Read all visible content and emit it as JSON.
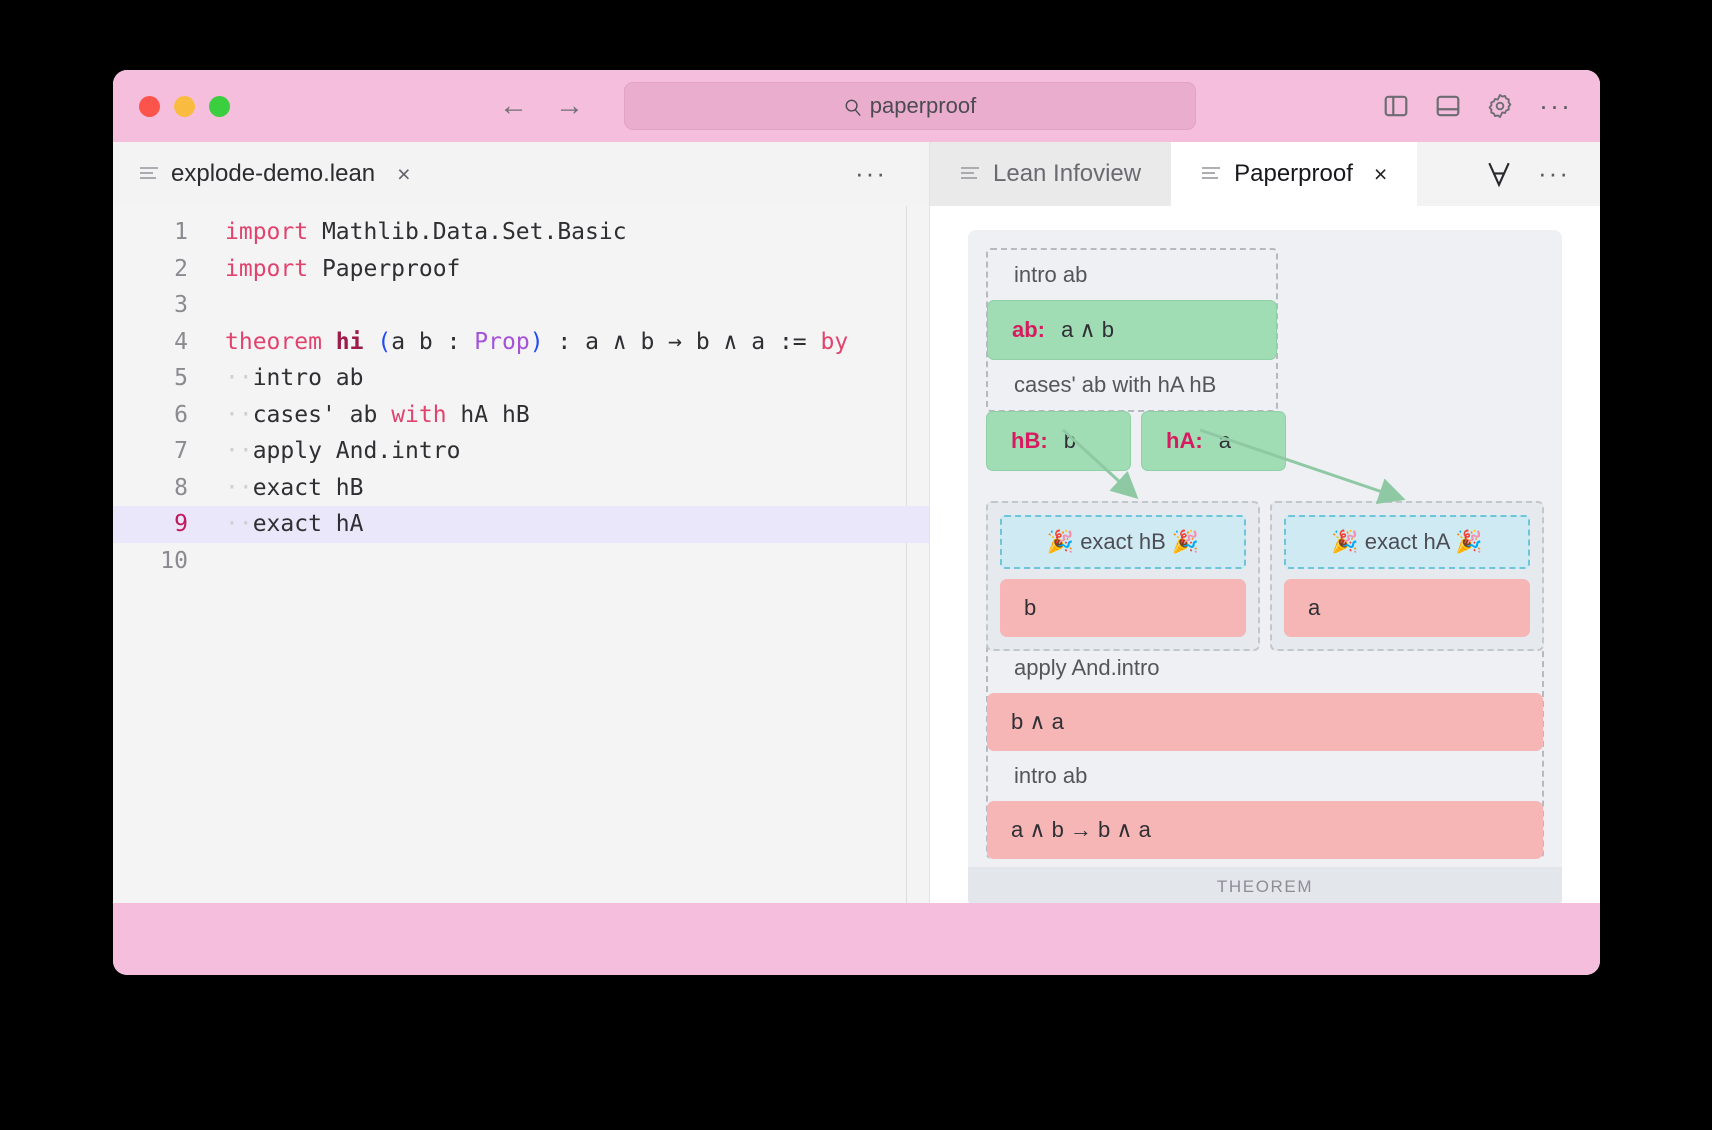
{
  "titlebar": {
    "search_value": "paperproof",
    "search_icon": "search-icon",
    "back_icon": "←",
    "forward_icon": "→",
    "overflow": "···",
    "accent_color": "#f4bedc"
  },
  "editor": {
    "tab_label": "explode-demo.lean",
    "tab_close": "×",
    "overflow": "···",
    "active_line": 9,
    "lines": [
      {
        "n": "1",
        "segments": [
          {
            "t": "import ",
            "c": "kw"
          },
          {
            "t": "Mathlib.Data.Set.Basic",
            "c": ""
          }
        ]
      },
      {
        "n": "2",
        "segments": [
          {
            "t": "import ",
            "c": "kw"
          },
          {
            "t": "Paperproof",
            "c": ""
          }
        ]
      },
      {
        "n": "3",
        "segments": []
      },
      {
        "n": "4",
        "segments": [
          {
            "t": "theorem ",
            "c": "kw"
          },
          {
            "t": "hi",
            "c": "kwb"
          },
          {
            "t": " ",
            "c": ""
          },
          {
            "t": "(",
            "c": "paren"
          },
          {
            "t": "a b : ",
            "c": ""
          },
          {
            "t": "Prop",
            "c": "type"
          },
          {
            "t": ")",
            "c": "paren"
          },
          {
            "t": " : a ∧ b → b ∧ a := ",
            "c": ""
          },
          {
            "t": "by",
            "c": "kw"
          }
        ]
      },
      {
        "n": "5",
        "segments": [
          {
            "t": "··",
            "c": "ws"
          },
          {
            "t": "intro ab",
            "c": ""
          }
        ]
      },
      {
        "n": "6",
        "segments": [
          {
            "t": "··",
            "c": "ws"
          },
          {
            "t": "cases' ab ",
            "c": ""
          },
          {
            "t": "with",
            "c": "kw"
          },
          {
            "t": " hA hB",
            "c": ""
          }
        ]
      },
      {
        "n": "7",
        "segments": [
          {
            "t": "··",
            "c": "ws"
          },
          {
            "t": "apply And.intro",
            "c": ""
          }
        ]
      },
      {
        "n": "8",
        "segments": [
          {
            "t": "··",
            "c": "ws"
          },
          {
            "t": "exact hB",
            "c": ""
          }
        ]
      },
      {
        "n": "9",
        "segments": [
          {
            "t": "··",
            "c": "ws"
          },
          {
            "t": "exact hA",
            "c": ""
          }
        ]
      },
      {
        "n": "10",
        "segments": []
      }
    ]
  },
  "panel": {
    "tabs": [
      {
        "label": "Lean Infoview",
        "active": false,
        "closable": false
      },
      {
        "label": "Paperproof",
        "active": true,
        "closable": true
      }
    ],
    "tab_close": "×",
    "forall_icon": "forall-icon",
    "overflow": "···"
  },
  "paperproof": {
    "footer_label": "THEOREM",
    "nodes": {
      "tactic_intro_ab_top": "intro ab",
      "hyp_ab": {
        "name": "ab:",
        "type": "a ∧ b"
      },
      "tactic_cases": "cases' ab with hA hB",
      "hyp_hB": {
        "name": "hB:",
        "type": "b"
      },
      "hyp_hA": {
        "name": "hA:",
        "type": "a"
      },
      "done_hB": "🎉  exact hB  🎉",
      "goal_b": "b",
      "done_hA": "🎉  exact hA  🎉",
      "goal_a": "a",
      "tactic_apply": "apply And.intro",
      "goal_b_and_a": "b ∧ a",
      "tactic_intro_ab_bottom": "intro ab",
      "goal_implication": "a ∧ b → b ∧ a"
    },
    "colors": {
      "hypothesis": "#a0dcb4",
      "goal": "#f6b6b6",
      "done": "#cfeaf3",
      "arrow": "#8fc9a4",
      "hyp_name": "#d81b60"
    }
  }
}
